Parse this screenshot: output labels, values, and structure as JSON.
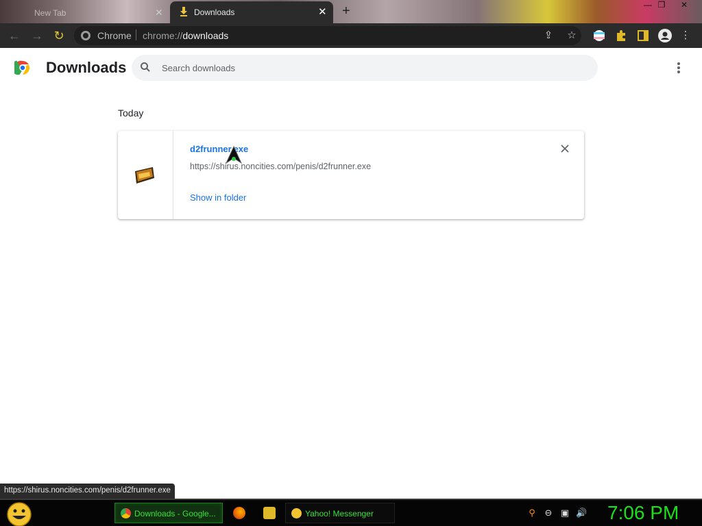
{
  "browser": {
    "inactive_tab_title": "New Tab",
    "active_tab_title": "Downloads",
    "omnibox": {
      "origin": "Chrome",
      "url_scheme": "chrome://",
      "url_host": "downloads"
    }
  },
  "page": {
    "title": "Downloads",
    "search_placeholder": "Search downloads"
  },
  "downloads": {
    "date_header": "Today",
    "items": [
      {
        "file_name": "d2frunner.exe",
        "url": "https://shirus.noncities.com/penis/d2frunner.exe",
        "action": "Show in folder"
      }
    ]
  },
  "status_bar": {
    "hover_url": "https://shirus.noncities.com/penis/d2frunner.exe"
  },
  "taskbar": {
    "tasks": [
      {
        "label": "Downloads - Google..."
      },
      {
        "label": "Yahoo! Messenger"
      }
    ],
    "clock": "7:06 PM"
  },
  "colors": {
    "link_blue": "#1a73e8",
    "taskbar_green": "#19e019",
    "toolbar_dark": "#2b2b2b"
  }
}
